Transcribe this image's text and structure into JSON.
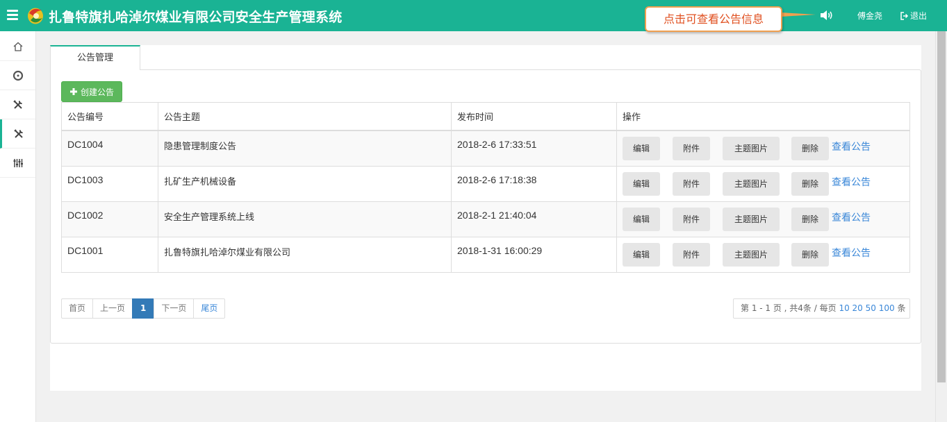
{
  "header": {
    "title": "扎鲁特旗扎哈淖尔煤业有限公司安全生产管理系统",
    "tooltip": "点击可查看公告信息",
    "username": "傅金尧",
    "logout_label": "退出"
  },
  "sidebar": {
    "items": [
      {
        "icon": "home-icon"
      },
      {
        "icon": "target-icon"
      },
      {
        "icon": "tools-icon"
      },
      {
        "icon": "tools-icon",
        "active": true
      },
      {
        "icon": "equalizer-icon"
      }
    ]
  },
  "tab": {
    "label": "公告管理"
  },
  "create_button": {
    "label": "创建公告"
  },
  "table": {
    "headers": [
      "公告编号",
      "公告主题",
      "发布时间",
      "操作"
    ],
    "rows": [
      {
        "id": "DC1004",
        "subject": "隐患管理制度公告",
        "time": "2018-2-6 17:33:51"
      },
      {
        "id": "DC1003",
        "subject": "扎矿生产机械设备",
        "time": "2018-2-6 17:18:38"
      },
      {
        "id": "DC1002",
        "subject": "安全生产管理系统上线",
        "time": "2018-2-1 21:40:04"
      },
      {
        "id": "DC1001",
        "subject": "扎鲁特旗扎哈淖尔煤业有限公司",
        "time": "2018-1-31 16:00:29"
      }
    ],
    "actions": {
      "edit": "编辑",
      "attach": "附件",
      "image": "主题图片",
      "delete": "删除",
      "view": "查看公告"
    }
  },
  "pagination": {
    "first": "首页",
    "prev": "上一页",
    "current": "1",
    "next": "下一页",
    "last": "尾页",
    "info_prefix": "第 1 - 1 页 , 共4条 / 每页",
    "sizes": [
      "10",
      "20",
      "50",
      "100"
    ],
    "info_suffix": "条"
  },
  "colors": {
    "brand": "#1ab394",
    "create_button": "#5cb85c",
    "link": "#3a87d8",
    "tooltip_text": "#e05020",
    "tooltip_border": "#f0a050"
  }
}
